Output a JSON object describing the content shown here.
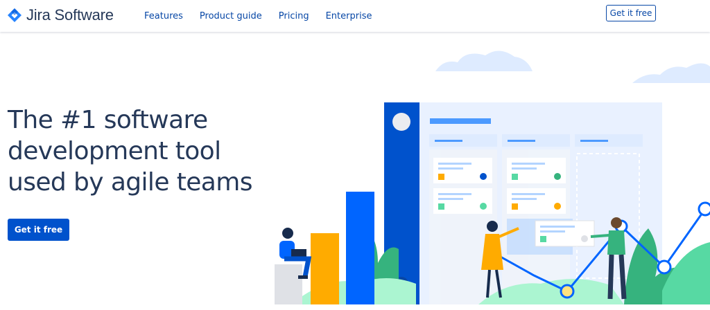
{
  "header": {
    "brand": "Jira Software",
    "nav": [
      {
        "label": "Features"
      },
      {
        "label": "Product guide"
      },
      {
        "label": "Pricing"
      },
      {
        "label": "Enterprise"
      }
    ],
    "cta_label": "Get it free"
  },
  "hero": {
    "title": "The #1 software development tool used by agile teams",
    "cta_label": "Get it free"
  },
  "colors": {
    "brand_blue": "#0052CC",
    "nav_link": "#0747A6",
    "heading": "#253858"
  },
  "icons": [
    "jira-logo-icon"
  ]
}
